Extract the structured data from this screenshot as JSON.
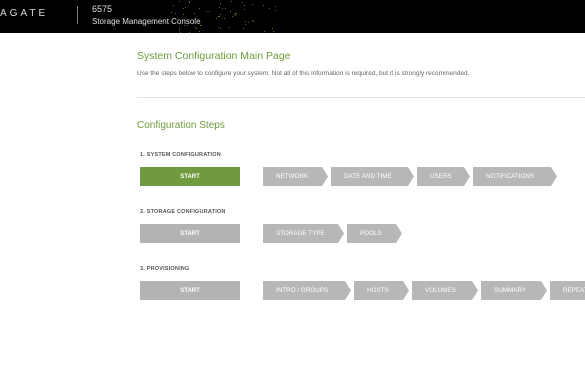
{
  "header": {
    "brand": "AGATE",
    "model": "6575",
    "app_title": "Storage Management Console"
  },
  "main": {
    "title": "System Configuration Main Page",
    "description": "Use the steps below to configure your system. Not all of this information is required, but it is strongly recommended.",
    "steps_title": "Configuration Steps"
  },
  "sections": [
    {
      "label": "1. SYSTEM CONFIGURATION",
      "start_label": "START",
      "active": true,
      "steps": [
        "NETWORK",
        "DATE AND TIME",
        "USERS",
        "NOTIFICATIONS"
      ]
    },
    {
      "label": "2. STORAGE CONFIGURATION",
      "start_label": "START",
      "active": false,
      "steps": [
        "STORAGE TYPE",
        "POOLS"
      ]
    },
    {
      "label": "3. PROVISIONING",
      "start_label": "START",
      "active": false,
      "steps": [
        "INTRO / GROUPS",
        "HOSTS",
        "VOLUMES",
        "SUMMARY",
        "REPEAT"
      ]
    }
  ],
  "colors": {
    "accent_green": "#6f9a3d",
    "step_gray": "#b7b7b7",
    "header_bg": "#000000"
  }
}
